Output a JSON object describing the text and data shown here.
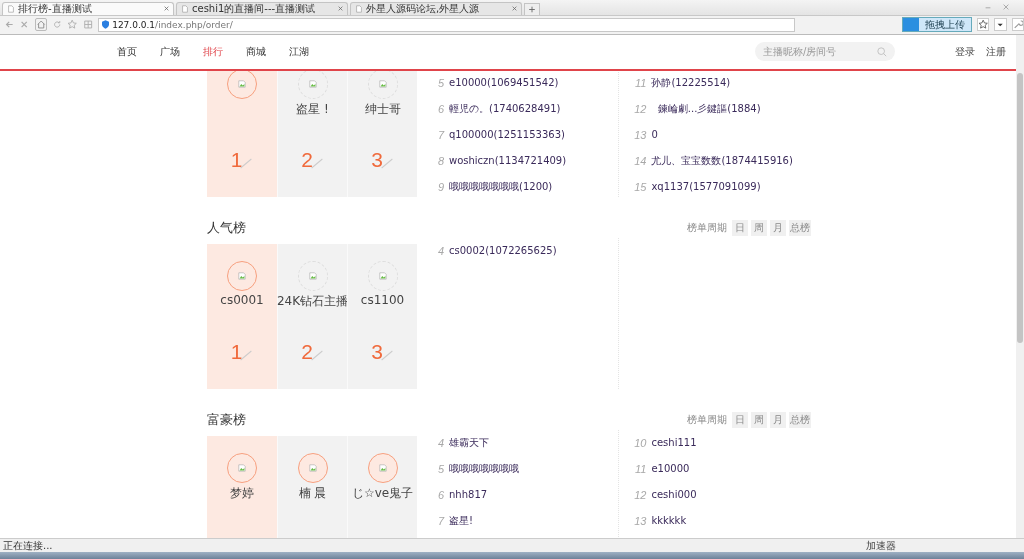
{
  "browser": {
    "tabs": [
      {
        "title": "排行榜-直播测试",
        "selected": true
      },
      {
        "title": "ceshi1的直播间---直播测试",
        "selected": false
      },
      {
        "title": "外星人源码论坛,外星人源",
        "selected": false
      }
    ],
    "url_host": "127.0.0.1",
    "url_path": "/index.php/order/",
    "upload_button": "拖拽上传"
  },
  "nav": {
    "items": [
      {
        "label": "首页",
        "selected": false
      },
      {
        "label": "广场",
        "selected": false
      },
      {
        "label": "排行",
        "selected": true
      },
      {
        "label": "商城",
        "selected": false
      },
      {
        "label": "江湖",
        "selected": false
      }
    ],
    "search": {
      "placeholder": "主播昵称/房间号"
    },
    "login": "登录",
    "register": "注册"
  },
  "sections": [
    {
      "podium": [
        {
          "rank": "1",
          "highlighted": true
        },
        {
          "rank": "2",
          "name": "盗星 !",
          "highlighted": false
        },
        {
          "rank": "3",
          "name": "绅士哥",
          "highlighted": false
        }
      ],
      "left": [
        {
          "rank": "5",
          "name": "e10000(1069451542)"
        },
        {
          "rank": "6",
          "name": "輕児の。(1740628491)"
        },
        {
          "rank": "7",
          "name": "q100000(1251153363)"
        },
        {
          "rank": "8",
          "name": "woshiczn(1134721409)"
        },
        {
          "rank": "9",
          "name": "哦哦哦哦哦哦哦(1200)"
        }
      ],
      "right": [
        {
          "rank": "11",
          "name": "孙静(12225514)"
        },
        {
          "rank": "12",
          "name": "  鍊崘劇...彡鍵謳(1884)"
        },
        {
          "rank": "13",
          "name": "0"
        },
        {
          "rank": "14",
          "name": "尤儿、宝宝数数(1874415916)"
        },
        {
          "rank": "15",
          "name": "xq1137(1577091099)"
        }
      ]
    },
    {
      "title": "人气榜",
      "period_label": "榜单周期",
      "periods": [
        "日",
        "周",
        "月",
        "总榜"
      ],
      "podium": [
        {
          "rank": "1",
          "name": "cs0001",
          "highlighted": true
        },
        {
          "rank": "2",
          "name": "24K钻石主播",
          "highlighted": false
        },
        {
          "rank": "3",
          "name": "cs1100",
          "highlighted": false
        }
      ],
      "left": [
        {
          "rank": "4",
          "name": "cs0002(1072265625)"
        }
      ]
    },
    {
      "title": "富豪榜",
      "period_label": "榜单周期",
      "periods": [
        "日",
        "周",
        "月",
        "总榜"
      ],
      "podium": [
        {
          "name": "梦婷",
          "highlighted": true
        },
        {
          "name": "楠 晨",
          "highlighted": true
        },
        {
          "name": "じ☆ve鬼子",
          "highlighted": true
        }
      ],
      "left": [
        {
          "rank": "4",
          "name": "雄霸天下"
        },
        {
          "rank": "5",
          "name": "哦哦哦哦哦哦哦"
        },
        {
          "rank": "6",
          "name": "nhh817"
        },
        {
          "rank": "7",
          "name": "盗星!"
        }
      ],
      "right": [
        {
          "rank": "10",
          "name": "ceshi111"
        },
        {
          "rank": "11",
          "name": "e10000"
        },
        {
          "rank": "12",
          "name": "ceshi000"
        },
        {
          "rank": "13",
          "name": "kkkkkk"
        }
      ]
    }
  ],
  "status": {
    "text": "正在连接...",
    "accelerator": "加速器"
  }
}
